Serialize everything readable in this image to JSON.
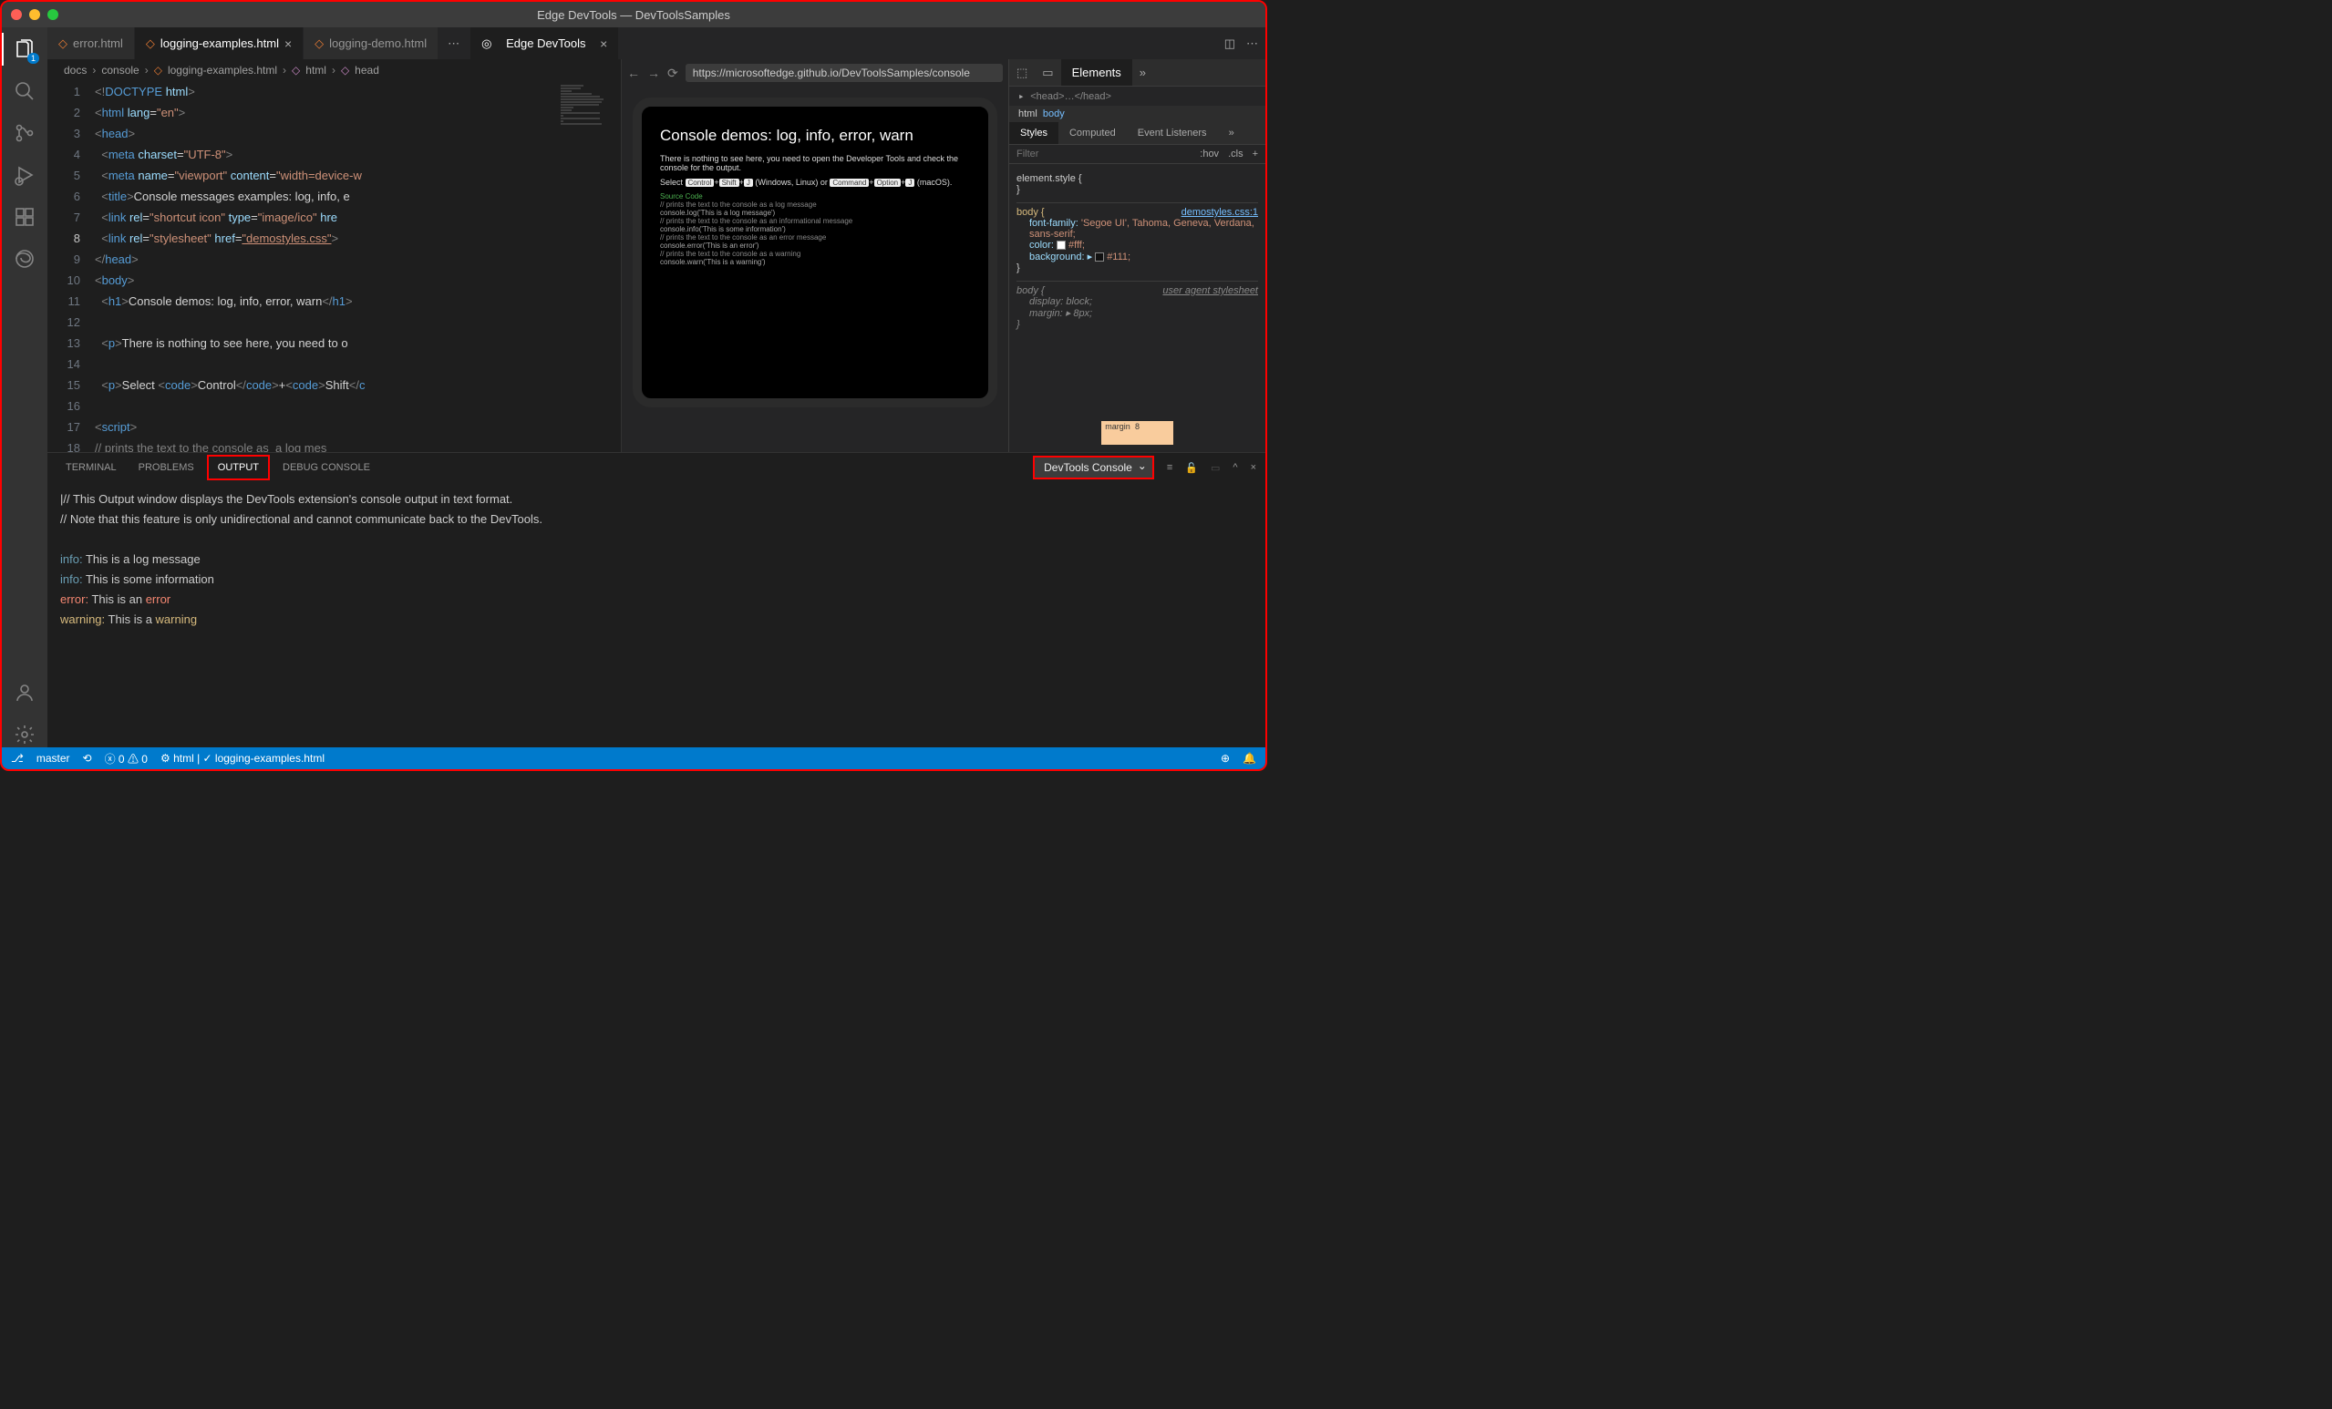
{
  "title": "Edge DevTools — DevToolsSamples",
  "activitybar": {
    "explorer_badge": "1"
  },
  "tabs": {
    "t1": "error.html",
    "t2": "logging-examples.html",
    "t3": "logging-demo.html",
    "devtools": "Edge DevTools"
  },
  "breadcrumb": {
    "p1": "docs",
    "p2": "console",
    "p3": "logging-examples.html",
    "p4": "html",
    "p5": "head"
  },
  "code": {
    "lines": [
      "1",
      "2",
      "3",
      "4",
      "5",
      "6",
      "7",
      "8",
      "9",
      "10",
      "11",
      "12",
      "13",
      "14",
      "15",
      "16",
      "17",
      "18"
    ],
    "current": "8"
  },
  "devtools": {
    "url": "https://microsoftedge.github.io/DevToolsSamples/console",
    "insp_tab": "Elements",
    "dom_head": "<head>…</head>",
    "crumb_html": "html",
    "crumb_body": "body",
    "styles_tabs": {
      "styles": "Styles",
      "computed": "Computed",
      "events": "Event Listeners"
    },
    "filter_ph": "Filter",
    "hov": ":hov",
    "cls": ".cls",
    "rules": {
      "r0_sel": "element.style {",
      "r1_sel": "body {",
      "r1_link": "demostyles.css:1",
      "r1_p1": "font-family:",
      "r1_v1": " 'Segoe UI', Tahoma, Geneva, Verdana, sans-serif;",
      "r1_p2": "color:",
      "r1_v2": "#fff;",
      "r1_p3": "background:",
      "r1_v3": "#111;",
      "r2_sel": "body {",
      "r2_src": "user agent stylesheet",
      "r2_p1": "display:",
      "r2_v1": " block;",
      "r2_p2": "margin:",
      "r2_v2": " 8px;"
    },
    "box": {
      "margin_label": "margin",
      "margin_val": "8"
    }
  },
  "preview": {
    "h1": "Console demos: log, info, error, warn",
    "p1": "There is nothing to see here, you need to open the Developer Tools and check the console for the output.",
    "select": "Select ",
    "win": " (Windows, Linux) or ",
    "mac": " (macOS).",
    "k_ctrl": "Control",
    "k_shift": "Shift",
    "k_j": "J",
    "k_cmd": "Command",
    "k_opt": "Option",
    "src_title": "Source Code",
    "c1": "// prints the text to the console as  a log message",
    "l1": "console.log('This is a log message')",
    "c2": "// prints the text to the console as an informational message",
    "l2": "console.info('This is some information')",
    "c3": "// prints the text to the console as an error message",
    "l3": "console.error('This is an error')",
    "c4": "// prints the text to the console as a warning",
    "l4": "console.warn('This is a warning')"
  },
  "panel": {
    "terminal": "TERMINAL",
    "problems": "PROBLEMS",
    "output": "OUTPUT",
    "debug": "DEBUG CONSOLE",
    "dropdown": "DevTools Console",
    "line1": "// This Output window displays the DevTools extension's console output in text format.",
    "line2": "// Note that this feature is only unidirectional and cannot communicate back to the DevTools.",
    "info_lbl": "info:",
    "err_lbl": "error:",
    "warn_lbl": "warning:",
    "m1": " This is a log message",
    "m2": " This is some information",
    "m3_a": " This is an ",
    "m3_b": "error",
    "m4_a": " This is a ",
    "m4_b": "warning"
  },
  "status": {
    "branch": "master",
    "errors": "0",
    "warnings": "0",
    "lang": "html",
    "file": "logging-examples.html"
  }
}
